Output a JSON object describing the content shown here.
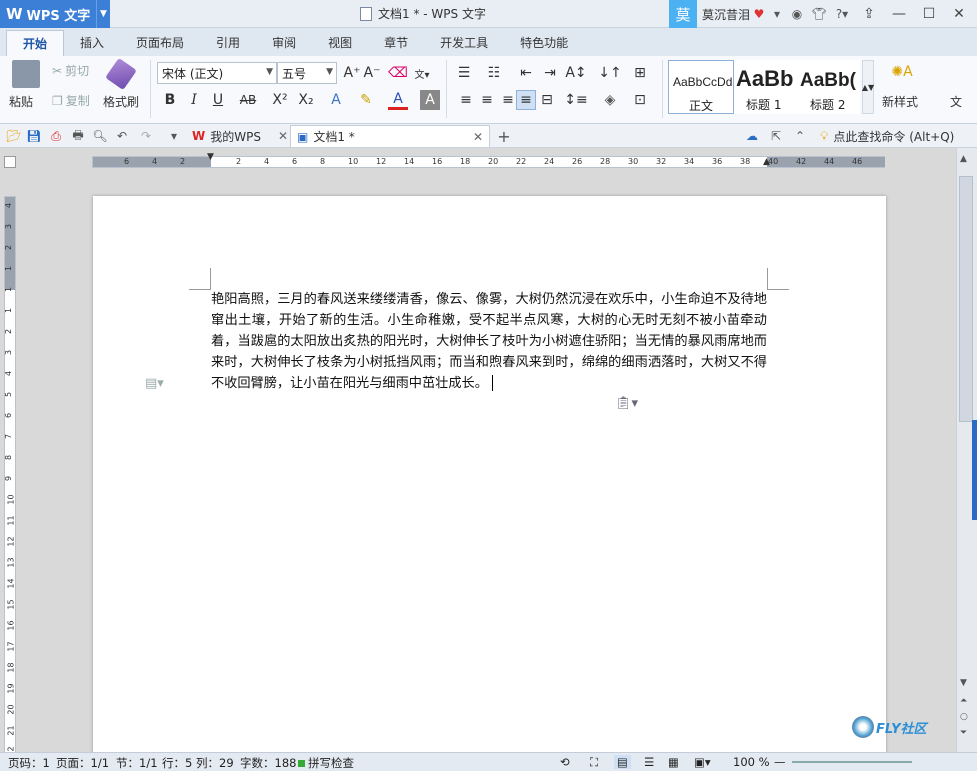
{
  "app": {
    "name": "WPS 文字",
    "logo": "W"
  },
  "window": {
    "title": "文档1 * - WPS 文字"
  },
  "user": {
    "avatar": "莫",
    "name": "莫沉昔泪"
  },
  "menu_tabs": [
    "开始",
    "插入",
    "页面布局",
    "引用",
    "审阅",
    "视图",
    "章节",
    "开发工具",
    "特色功能"
  ],
  "ribbon": {
    "paste": "粘贴",
    "cut": "剪切",
    "copy": "复制",
    "format_painter": "格式刷",
    "font_name": "宋体 (正文)",
    "font_size": "五号",
    "styles": [
      {
        "preview": "AaBbCcDd",
        "label": "正文"
      },
      {
        "preview": "AaBb",
        "label": "标题 1"
      },
      {
        "preview": "AaBb(",
        "label": "标题 2"
      }
    ],
    "new_style": "新样式",
    "more": "文"
  },
  "quick_access": {
    "doc_tabs": [
      {
        "label": "我的WPS",
        "active": false
      },
      {
        "label": "文档1 *",
        "active": true
      }
    ],
    "search_command": "点此查找命令 (Alt+Q)"
  },
  "ruler": {
    "h_numbers": [
      "6",
      "4",
      "2",
      "2",
      "4",
      "6",
      "8",
      "10",
      "12",
      "14",
      "16",
      "18",
      "20",
      "22",
      "24",
      "26",
      "28",
      "30",
      "32",
      "34",
      "36",
      "38",
      "40",
      "42",
      "44",
      "46"
    ],
    "v_numbers": [
      "4",
      "3",
      "2",
      "1",
      "1",
      "1",
      "2",
      "3",
      "4",
      "5",
      "6",
      "7",
      "8",
      "9",
      "10",
      "11",
      "12",
      "13",
      "14",
      "15",
      "16",
      "17",
      "18",
      "19",
      "20",
      "21",
      "22"
    ]
  },
  "document": {
    "text": "艳阳高照，三月的春风送来缕缕清香，像云、像雾，大树仍然沉浸在欢乐中，小生命迫不及待地窜出土壤，开始了新的生活。小生命稚嫩，受不起半点风寒，大树的心无时无刻不被小苗牵动着，当跋扈的太阳放出炙热的阳光时，大树伸长了枝叶为小树遮住骄阳；当无情的暴风雨席地而来时，大树伸长了枝条为小树抵挡风雨；而当和煦春风来到时，绵绵的细雨洒落时，大树又不得不收回臂膀，让小苗在阳光与细雨中茁壮成长。"
  },
  "status_bar": {
    "page_num": "页码：1",
    "pages": "页面：1/1",
    "section": "节：1/1",
    "row": "行：5",
    "col": "列：29",
    "words": "字数：188",
    "spell": "拼写检查",
    "zoom": "100 %"
  },
  "watermark": "FLY社区",
  "colors": {
    "accent": "#3b7fd6",
    "tab_active": "#1d56a5",
    "avatar": "#4cb1f2"
  }
}
